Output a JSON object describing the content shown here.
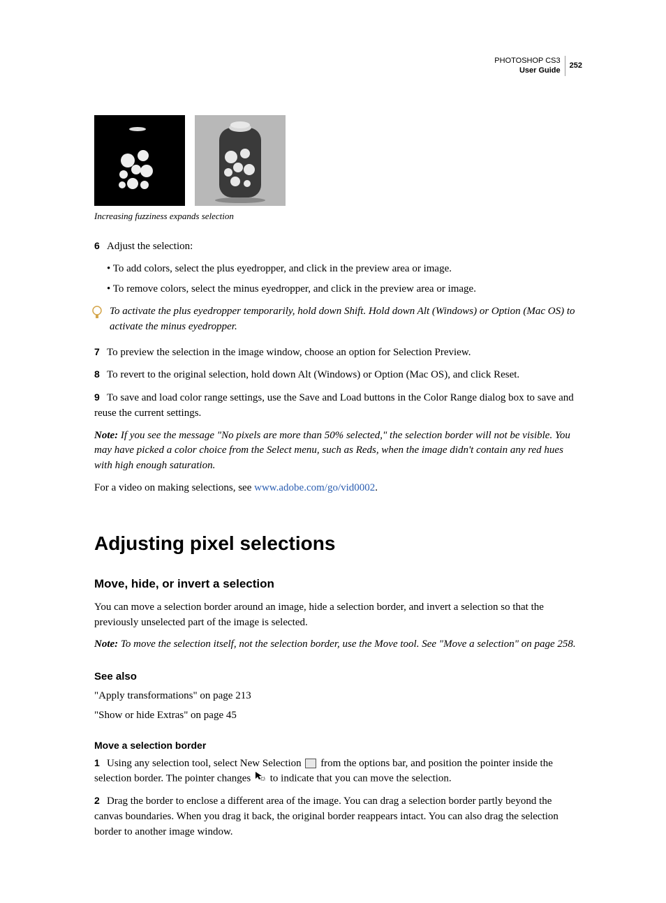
{
  "header": {
    "product": "PHOTOSHOP CS3",
    "guide": "User Guide",
    "page": "252"
  },
  "figure": {
    "caption": "Increasing fuzziness expands selection"
  },
  "steps": {
    "s6": {
      "num": "6",
      "text": "Adjust the selection:"
    },
    "b1": "To add colors, select the plus eyedropper, and click in the preview area or image.",
    "b2": "To remove colors, select the minus eyedropper, and click in the preview area or image.",
    "tip": "To activate the plus eyedropper temporarily, hold down Shift. Hold down Alt (Windows) or Option (Mac OS) to activate the minus eyedropper.",
    "s7": {
      "num": "7",
      "text": "To preview the selection in the image window, choose an option for Selection Preview."
    },
    "s8": {
      "num": "8",
      "text": "To revert to the original selection, hold down Alt (Windows) or Option (Mac OS), and click Reset."
    },
    "s9": {
      "num": "9",
      "text": "To save and load color range settings, use the Save and Load buttons in the Color Range dialog box to save and reuse the current settings."
    }
  },
  "note1": {
    "label": "Note:",
    "text": " If you see the message \"No pixels are more than 50% selected,\" the selection border will not be visible. You may have picked a color choice from the Select menu, such as Reds, when the image didn't contain any red hues with high enough saturation."
  },
  "videoline": {
    "prefix": "For a video on making selections, see ",
    "link": "www.adobe.com/go/vid0002",
    "suffix": "."
  },
  "h1": "Adjusting pixel selections",
  "h2a": "Move, hide, or invert a selection",
  "p_intro": "You can move a selection border around an image, hide a selection border, and invert a selection so that the previously unselected part of the image is selected.",
  "note2": {
    "label": "Note:",
    "text": " To move the selection itself, not the selection border, use the Move tool. See \"Move a selection\" on page 258."
  },
  "seealso": {
    "title": "See also",
    "i1": "\"Apply transformations\" on page 213",
    "i2": "\"Show or hide Extras\" on page 45"
  },
  "h4a": "Move a selection border",
  "moveStep1": {
    "num": "1",
    "part1": "Using any selection tool, select New Selection ",
    "part2": " from the options bar, and position the pointer inside the selection border. The pointer changes ",
    "part3": " to indicate that you can move the selection."
  },
  "moveStep2": {
    "num": "2",
    "text": "Drag the border to enclose a different area of the image. You can drag a selection border partly beyond the canvas boundaries. When you drag it back, the original border reappears intact. You can also drag the selection border to another image window."
  }
}
